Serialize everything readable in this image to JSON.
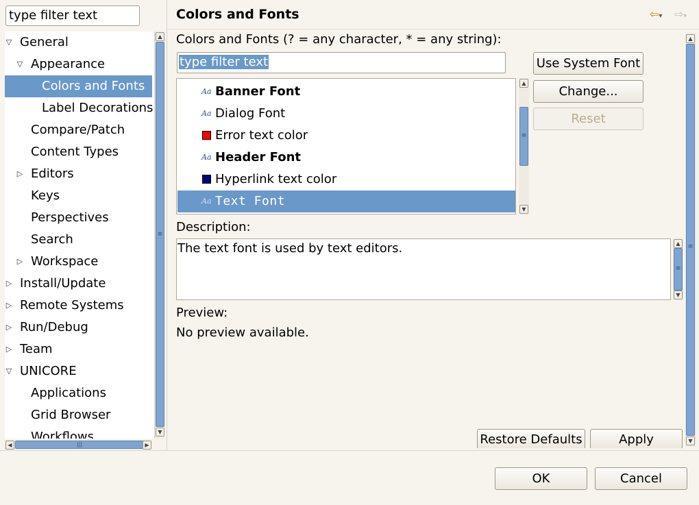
{
  "filter": {
    "value": "type filter text"
  },
  "tree": {
    "items": [
      {
        "label": "General",
        "level": 0,
        "twisty": "expanded"
      },
      {
        "label": "Appearance",
        "level": 1,
        "twisty": "expanded"
      },
      {
        "label": "Colors and Fonts",
        "level": 2,
        "twisty": "none",
        "selected": true
      },
      {
        "label": "Label Decorations",
        "level": 2,
        "twisty": "none"
      },
      {
        "label": "Compare/Patch",
        "level": 1,
        "twisty": "none"
      },
      {
        "label": "Content Types",
        "level": 1,
        "twisty": "none"
      },
      {
        "label": "Editors",
        "level": 1,
        "twisty": "collapsed"
      },
      {
        "label": "Keys",
        "level": 1,
        "twisty": "none"
      },
      {
        "label": "Perspectives",
        "level": 1,
        "twisty": "none"
      },
      {
        "label": "Search",
        "level": 1,
        "twisty": "none"
      },
      {
        "label": "Workspace",
        "level": 1,
        "twisty": "collapsed"
      },
      {
        "label": "Install/Update",
        "level": 0,
        "twisty": "collapsed"
      },
      {
        "label": "Remote Systems",
        "level": 0,
        "twisty": "collapsed"
      },
      {
        "label": "Run/Debug",
        "level": 0,
        "twisty": "collapsed"
      },
      {
        "label": "Team",
        "level": 0,
        "twisty": "collapsed"
      },
      {
        "label": "UNICORE",
        "level": 0,
        "twisty": "expanded"
      },
      {
        "label": "Applications",
        "level": 1,
        "twisty": "none"
      },
      {
        "label": "Grid Browser",
        "level": 1,
        "twisty": "none"
      },
      {
        "label": "Workflows",
        "level": 1,
        "twisty": "none"
      }
    ]
  },
  "page": {
    "title": "Colors and Fonts",
    "colors_fonts_label": "Colors and Fonts (? = any character, * = any string):",
    "filter_value": "type filter text",
    "list": [
      {
        "label": "Banner Font",
        "kind": "font",
        "style": "bold"
      },
      {
        "label": "Dialog Font",
        "kind": "font",
        "style": "normal"
      },
      {
        "label": "Error text color",
        "kind": "color",
        "color": "#ff0000"
      },
      {
        "label": "Header Font",
        "kind": "font",
        "style": "bold"
      },
      {
        "label": "Hyperlink text color",
        "kind": "color",
        "color": "#000080"
      },
      {
        "label": "Text Font",
        "kind": "font",
        "style": "mono",
        "selected": true
      }
    ],
    "buttons": {
      "use_system_font": "Use System Font",
      "change": "Change...",
      "reset": "Reset"
    },
    "description_label": "Description:",
    "description_text": "The text font is used by text editors.",
    "preview_label": "Preview:",
    "preview_text": "No preview available.",
    "restore_defaults": "Restore Defaults",
    "apply": "Apply"
  },
  "dialog": {
    "ok": "OK",
    "cancel": "Cancel"
  },
  "icons": {
    "font_item": "Aa",
    "back": "⇦",
    "forward": "⇨"
  },
  "colors": {
    "selection": "#6a98c9",
    "background": "#f7f4ee"
  }
}
